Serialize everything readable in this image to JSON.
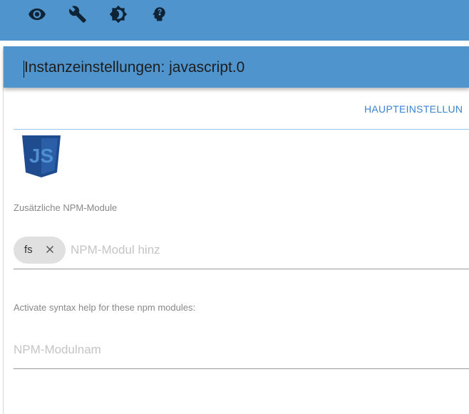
{
  "toolbar": {
    "icons": [
      "eye-icon",
      "wrench-icon",
      "brightness-icon",
      "head-profile-icon"
    ]
  },
  "dialog": {
    "title": "Instanzeinstellungen: javascript.0",
    "tab_label": "HAUPTEINSTELLUN",
    "logo_text": "JS"
  },
  "npm_modules": {
    "label": "Zusätzliche NPM-Module",
    "chips": [
      "fs"
    ],
    "placeholder": "NPM-Modul hinz"
  },
  "syntax_help": {
    "label": "Activate syntax help for these npm modules:",
    "placeholder": "NPM-Modulnam"
  },
  "colors": {
    "header_blue": "#4f94cd",
    "tab_blue": "#3a83d0",
    "js_logo_dark": "#1e4c8f",
    "js_logo_light": "#4f8fcf"
  }
}
